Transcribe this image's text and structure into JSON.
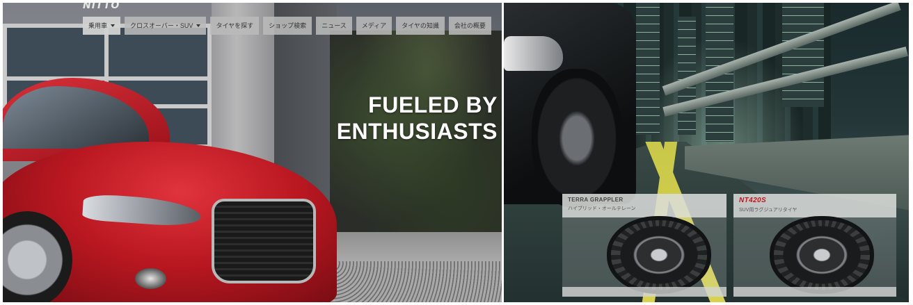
{
  "header": {
    "logo_text": "NITTO",
    "nav": [
      {
        "label": "乗用車",
        "has_caret": true
      },
      {
        "label": "クロスオーバー・SUV",
        "has_caret": true
      },
      {
        "label": "タイヤを探す",
        "has_caret": false
      },
      {
        "label": "ショップ検索",
        "has_caret": false
      },
      {
        "label": "ニュース",
        "has_caret": false
      },
      {
        "label": "メディア",
        "has_caret": false
      },
      {
        "label": "タイヤの知識",
        "has_caret": false
      },
      {
        "label": "会社の概要",
        "has_caret": false
      }
    ]
  },
  "hero": {
    "headline_line1": "FUELED BY",
    "headline_line2": "ENTHUSIASTS"
  },
  "products": [
    {
      "brand": "TERRA GRAPPLER",
      "subtitle": "ハイブリッド・オールテレーン"
    },
    {
      "brand": "NT420S",
      "subtitle": "SUV用ラグジュアリタイヤ"
    }
  ],
  "colors": {
    "headline": "#ffffff",
    "nav_bg": "#b9b9b9",
    "brand_red": "#c2131b"
  }
}
